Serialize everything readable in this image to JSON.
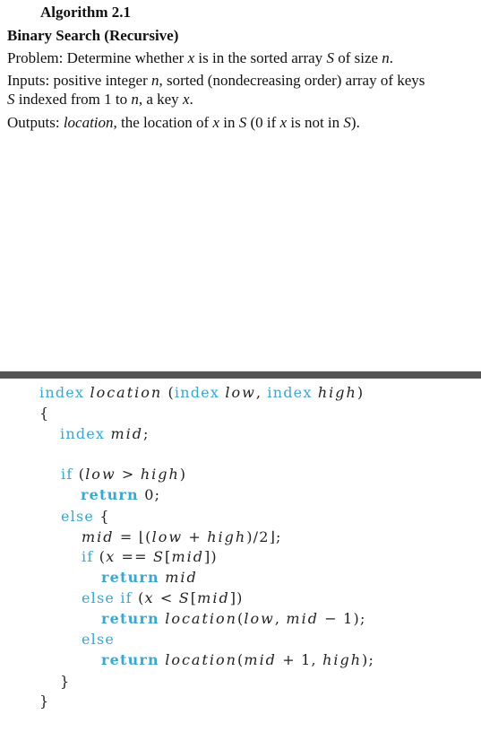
{
  "algorithm": {
    "title": "Algorithm 2.1",
    "name": "Binary Search (Recursive)",
    "problem": {
      "label": "Problem:",
      "text_1": " Determine whether ",
      "var_x": "x",
      "text_2": " is in the sorted array ",
      "var_S": "S",
      "text_3": " of size ",
      "var_n": "n",
      "text_4": "."
    },
    "inputs": {
      "label": "Inputs:",
      "text_1": " positive integer ",
      "var_n": "n",
      "text_2": ", sorted (nondecreasing order) array of keys",
      "var_S": "S",
      "text_3": " indexed from 1 to ",
      "var_n2": "n",
      "text_4": ", a key ",
      "var_x": "x",
      "text_5": "."
    },
    "outputs": {
      "label": "Outputs:",
      "var_location": "location",
      "text_1": ", the location of ",
      "var_x": "x",
      "text_2": " in ",
      "var_S": "S",
      "text_3": " (0 if ",
      "var_x2": "x",
      "text_4": " is not in ",
      "var_S2": "S",
      "text_5": ")."
    }
  },
  "code": {
    "keyword_color": "#3aa7d0",
    "lines": [
      {
        "tokens": [
          "index",
          " ",
          "location",
          " (",
          "index",
          " ",
          "low",
          ", ",
          "index",
          " ",
          "high",
          ")"
        ]
      },
      {
        "text": "{"
      },
      {
        "tokens": [
          "index",
          " ",
          "mid",
          ";"
        ]
      },
      {
        "tokens": [
          "if",
          " (",
          "low",
          " > ",
          "high",
          ")"
        ]
      },
      {
        "tokens": [
          "return",
          " 0;"
        ]
      },
      {
        "tokens": [
          "else",
          " {"
        ]
      },
      {
        "tokens": [
          "mid",
          " = ⌊(",
          "low",
          " + ",
          "high",
          ")/2⌋;"
        ]
      },
      {
        "tokens": [
          "if",
          " (",
          "x",
          " == ",
          "S",
          "[",
          "mid",
          "])"
        ]
      },
      {
        "tokens": [
          "return",
          " ",
          "mid"
        ]
      },
      {
        "tokens": [
          "else if",
          " (",
          "x",
          " < ",
          "S",
          "[",
          "mid",
          "])"
        ]
      },
      {
        "tokens": [
          "return",
          " ",
          "location",
          "(",
          "low",
          ", ",
          "mid",
          " − 1);"
        ]
      },
      {
        "tokens": [
          "else"
        ]
      },
      {
        "tokens": [
          "return",
          " ",
          "location",
          "(",
          "mid",
          " + 1, ",
          "high",
          ");"
        ]
      },
      {
        "text": "}"
      },
      {
        "text": "}"
      }
    ]
  }
}
